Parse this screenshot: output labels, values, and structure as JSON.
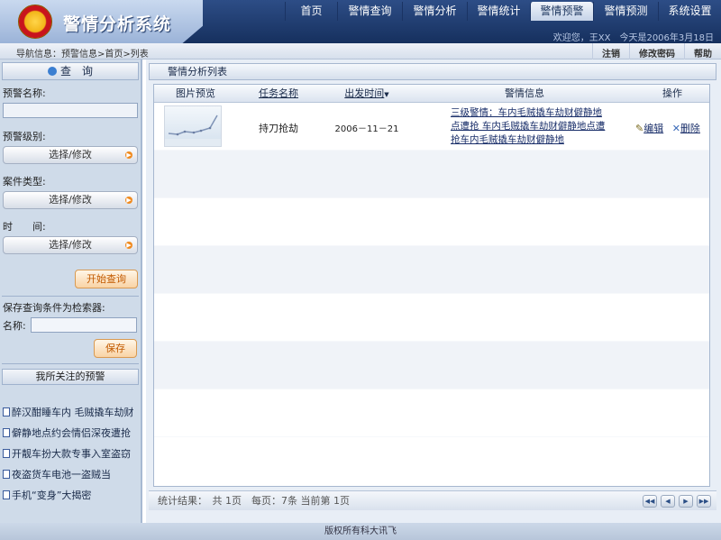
{
  "app": {
    "title": "警情分析系统"
  },
  "nav": {
    "items": [
      "首页",
      "警情查询",
      "警情分析",
      "警情统计",
      "警情预警",
      "警情预测",
      "系统设置"
    ],
    "active_index": 4
  },
  "user": {
    "welcome": "欢迎您，王XX　今天是2006年3月18日"
  },
  "breadcrumb": {
    "text": "导航信息：预警信息>首页>列表",
    "actions": [
      "注销",
      "修改密码",
      "帮助"
    ]
  },
  "sidebar": {
    "query_title": "查　询",
    "name_label": "预警名称:",
    "level_label": "预警级别:",
    "case_type_label": "案件类型:",
    "time_label": "时　　间:",
    "select_label": "选择/修改",
    "start_query": "开始查询",
    "save_label": "保存查询条件为检索器:",
    "save_name_label": "名称:",
    "save_button": "保存",
    "watch_title": "我所关注的预警",
    "watch_items": [
      "醉汉酣睡车内 毛贼撬车劫财",
      "僻静地点约会情侣深夜遭抢",
      "开靓车扮大款专事入室盗窃",
      "夜盗货车电池一盗贼当",
      "手机“变身”大揭密"
    ]
  },
  "main": {
    "title": "警情分析列表",
    "columns": [
      "图片预览",
      "任务名称",
      "出发时间",
      "警情信息",
      "操作"
    ],
    "rows": [
      {
        "task": "持刀抢劫",
        "time": "2006－11－21",
        "info": [
          "三级警情：车内毛贼撬车劫财僻静地",
          "点遭抢 车内毛贼撬车劫财僻静地点遭",
          "抢车内毛贼撬车劫财僻静地"
        ],
        "edit": "编辑",
        "delete": "删除"
      }
    ],
    "stats": "统计结果：　共 1页　每页：7条 当前第 1页",
    "pager": [
      "first",
      "prev",
      "next",
      "last"
    ]
  },
  "footer": {
    "copyright": "版权所有科大讯飞"
  },
  "colors": {
    "header": "#1f3b70",
    "active_tab": "#c5d3e8",
    "accent_orange": "#f08a1e"
  }
}
